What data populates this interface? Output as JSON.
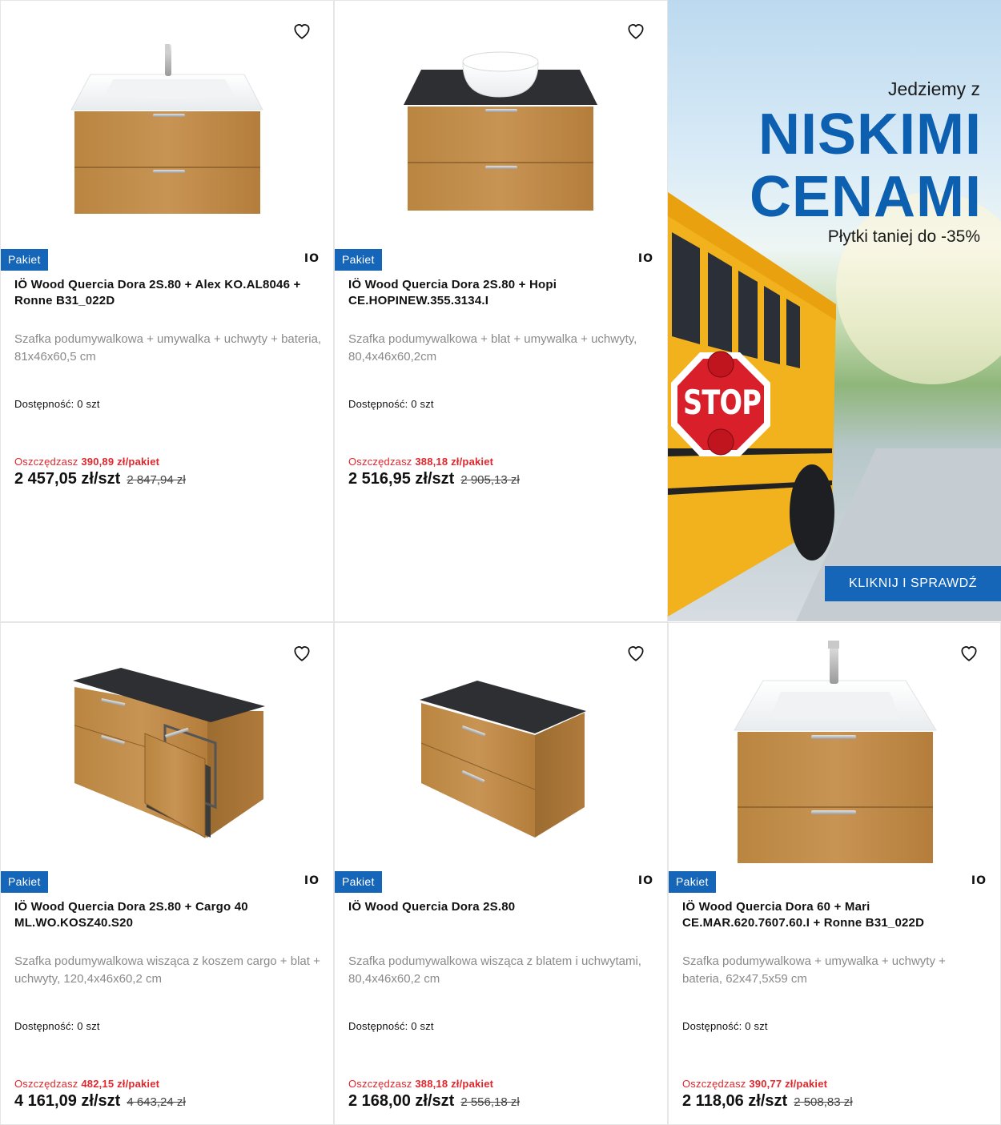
{
  "products": [
    {
      "badge": "Pakiet",
      "brand": "IO",
      "title": "IÖ Wood Quercia Dora 2S.80 + Alex KO.AL8046 + Ronne B31_022D",
      "description": "Szafka podumywalkowa + umywalka + uchwyty + bateria, 81x46x60,5 cm",
      "availability": "Dostępność: 0 szt",
      "save_label": "Oszczędzasz",
      "save_value": "390,89 zł/pakiet",
      "price": "2 457,05 zł/szt",
      "old_price": "2 847,94 zł",
      "image": "vanity-with-sink-icon"
    },
    {
      "badge": "Pakiet",
      "brand": "IO",
      "title": "IÖ Wood Quercia Dora 2S.80 + Hopi CE.HOPINEW.355.3134.I",
      "description": "Szafka podumywalkowa + blat + umywalka + uchwyty, 80,4x46x60,2cm",
      "availability": "Dostępność: 0 szt",
      "save_label": "Oszczędzasz",
      "save_value": "388,18 zł/pakiet",
      "price": "2 516,95 zł/szt",
      "old_price": "2 905,13 zł",
      "image": "vanity-with-bowl-icon"
    },
    {
      "badge": "Pakiet",
      "brand": "IO",
      "title": "IÖ Wood Quercia Dora 2S.80 + Cargo 40 ML.WO.KOSZ40.S20",
      "description": "Szafka podumywalkowa wisząca z koszem cargo + blat + uchwyty, 120,4x46x60,2 cm",
      "availability": "Dostępność: 0 szt",
      "save_label": "Oszczędzasz",
      "save_value": "482,15 zł/pakiet",
      "price": "4 161,09 zł/szt",
      "old_price": "4 643,24 zł",
      "image": "vanity-with-cargo-icon"
    },
    {
      "badge": "Pakiet",
      "brand": "IO",
      "title": "IÖ Wood Quercia Dora 2S.80",
      "description": "Szafka podumywalkowa wisząca z blatem i uchwytami, 80,4x46x60,2 cm",
      "availability": "Dostępność: 0 szt",
      "save_label": "Oszczędzasz",
      "save_value": "388,18 zł/pakiet",
      "price": "2 168,00 zł/szt",
      "old_price": "2 556,18 zł",
      "image": "vanity-with-top-icon"
    },
    {
      "badge": "Pakiet",
      "brand": "IO",
      "title": "IÖ Wood Quercia Dora 60 + Mari CE.MAR.620.7607.60.I + Ronne B31_022D",
      "description": "Szafka podumywalkowa + umywalka + uchwyty + bateria, 62x47,5x59 cm",
      "availability": "Dostępność: 0 szt",
      "save_label": "Oszczędzasz",
      "save_value": "390,77 zł/pakiet",
      "price": "2 118,06 zł/szt",
      "old_price": "2 508,83 zł",
      "image": "vanity-narrow-with-sink-icon"
    }
  ],
  "banner": {
    "top_text": "Jedziemy z",
    "line1": "NISKIMI",
    "line2": "CENAMI",
    "subtext": "Płytki taniej do -35%",
    "stop_text": "STOP",
    "cta": "KLIKNIJ I SPRAWDŹ"
  },
  "colors": {
    "badge": "#1565b8",
    "save": "#e1262c",
    "banner_heading": "#0d5fb0",
    "wood": "#c08a45",
    "countertop": "#2e2f33"
  }
}
